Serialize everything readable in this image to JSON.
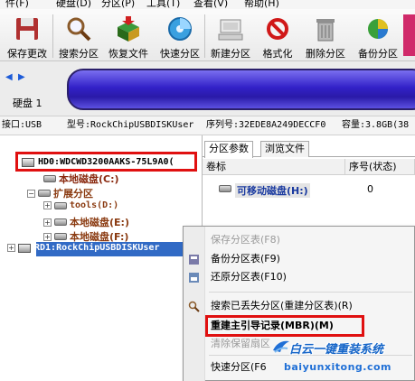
{
  "menubar": {
    "items": [
      "件(F)",
      "硬盘(D)",
      "分区(P)",
      "工具(T)",
      "查看(V)",
      "帮助(H)"
    ]
  },
  "toolbar": {
    "buttons": [
      {
        "label": "保存更改",
        "icon": "save-icon"
      },
      {
        "label": "搜索分区",
        "icon": "magnifier-icon"
      },
      {
        "label": "恢复文件",
        "icon": "restore-box-icon"
      },
      {
        "label": "快速分区",
        "icon": "quick-partition-disc-icon"
      },
      {
        "label": "新建分区",
        "icon": "computer-drive-icon"
      },
      {
        "label": "格式化",
        "icon": "format-icon"
      },
      {
        "label": "删除分区",
        "icon": "trash-icon"
      },
      {
        "label": "备份分区",
        "icon": "backup-pie-icon"
      }
    ]
  },
  "disk_bar": {
    "label": "硬盘 1"
  },
  "disk_info": {
    "interface": "接口:USB",
    "model": "型号:RockChipUSBDISKUser",
    "serial": "序列号:32EDE8A249DECCF0",
    "capacity": "容量:3.8GB(38"
  },
  "tree": {
    "hd0": "HD0:WDCWD3200AAKS-75L9A0(",
    "local_disk_c": "本地磁盘(C:)",
    "extended": "扩展分区",
    "tools": "tools(D:)",
    "local_disk_e": "本地磁盘(E:)",
    "local_disk_f": "本地磁盘(F:)",
    "rd1": "RD1:RockChipUSBDISKUser"
  },
  "right_panel": {
    "tabs": [
      "分区参数",
      "浏览文件"
    ],
    "columns": [
      "卷标",
      "序号(状态)"
    ],
    "row": {
      "label": "可移动磁盘(H:)",
      "index": "0"
    }
  },
  "context_menu": {
    "items": [
      {
        "label": "保存分区表(F8)",
        "disabled": true
      },
      {
        "label": "备份分区表(F9)",
        "disabled": false
      },
      {
        "label": "还原分区表(F10)",
        "disabled": false
      },
      {
        "label": "搜索已丢失分区(重建分区表)(R)",
        "disabled": false
      },
      {
        "label": "重建主引导记录(MBR)(M)",
        "disabled": false
      },
      {
        "label": "清除保留扇区",
        "disabled": true
      },
      {
        "label": "快速分区(F6",
        "disabled": false
      }
    ]
  },
  "watermark": {
    "title": "白云一键重装系统",
    "url": "baiyunxitong.com"
  },
  "colors": {
    "highlight_red": "#e01010",
    "selection_blue": "#316ac5",
    "disk_blue": "#3221c8"
  }
}
